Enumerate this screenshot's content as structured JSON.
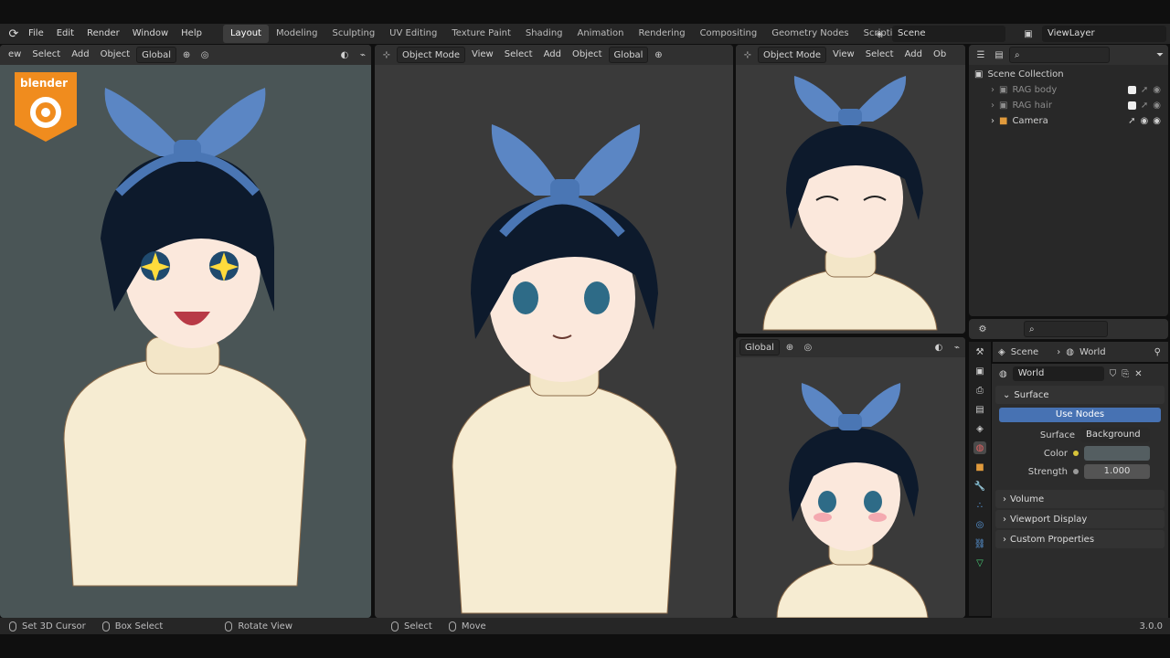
{
  "app": {
    "logo_glyph": "⟳",
    "version": "3.0.0"
  },
  "menu": {
    "items": [
      "File",
      "Edit",
      "Render",
      "Window",
      "Help"
    ]
  },
  "workspaces": {
    "tabs": [
      "Layout",
      "Modeling",
      "Sculpting",
      "UV Editing",
      "Texture Paint",
      "Shading",
      "Animation",
      "Rendering",
      "Compositing",
      "Geometry Nodes",
      "Scripting"
    ],
    "active": "Layout",
    "add": "+"
  },
  "scene": {
    "name": "Scene",
    "view_layer": "ViewLayer"
  },
  "viewport1": {
    "header": [
      "ew",
      "Select",
      "Add",
      "Object"
    ],
    "transform": "Global",
    "bg_color": "#4a5556",
    "logo_text": "blender"
  },
  "viewport2": {
    "mode": "Object Mode",
    "menus": [
      "View",
      "Select",
      "Add",
      "Object"
    ],
    "transform": "Global"
  },
  "viewport3": {
    "mode": "Object Mode",
    "menus": [
      "View",
      "Select",
      "Add",
      "Ob"
    ]
  },
  "viewport4": {
    "transform": "Global"
  },
  "outliner": {
    "root": "Scene Collection",
    "items": [
      {
        "label": "RAG body",
        "dim": true
      },
      {
        "label": "RAG hair",
        "dim": true
      },
      {
        "label": "Camera",
        "dim": false
      }
    ]
  },
  "properties": {
    "breadcrumb": [
      "Scene",
      "World"
    ],
    "world_name": "World",
    "sections": {
      "surface": "Surface",
      "volume": "Volume",
      "viewport_display": "Viewport Display",
      "custom_properties": "Custom Properties"
    },
    "use_nodes": "Use Nodes",
    "surface_label": "Surface",
    "surface_value": "Background",
    "color_label": "Color",
    "color_value": "#545e61",
    "strength_label": "Strength",
    "strength_value": "1.000"
  },
  "statusbar": {
    "items": [
      "Set 3D Cursor",
      "Box Select",
      "Rotate View",
      "Select",
      "Move"
    ]
  }
}
